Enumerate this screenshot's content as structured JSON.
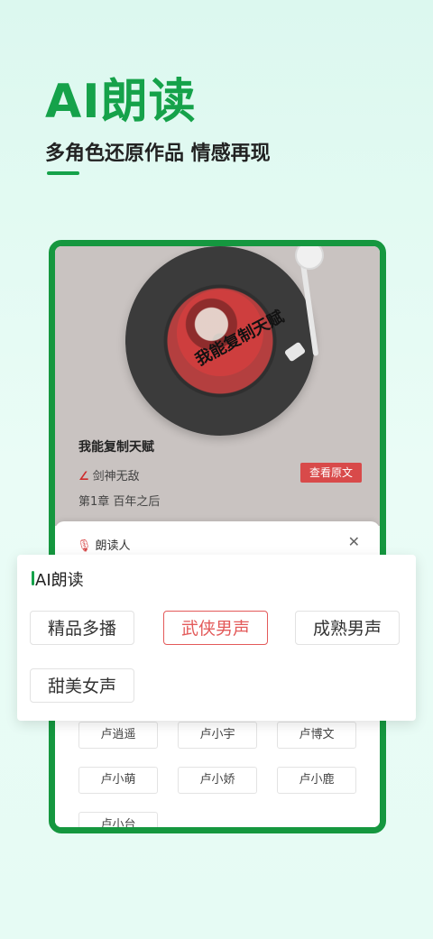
{
  "header": {
    "title": "AI朗读",
    "subtitle": "多角色还原作品  情感再现"
  },
  "book": {
    "disc_text": "我能复制天赋",
    "title": "我能复制天赋",
    "author": "剑神无敌",
    "view_button": "查看原文",
    "chapter": "第1章 百年之后"
  },
  "reader_panel": {
    "title": "朗读人",
    "voices": [
      "卢逍遥",
      "卢小宇",
      "卢博文",
      "卢小萌",
      "卢小娇",
      "卢小鹿",
      "卢小台"
    ]
  },
  "ai_overlay": {
    "title": "AI朗读",
    "options": [
      "精品多播",
      "武侠男声",
      "成熟男声",
      "甜美女声"
    ],
    "selected": "武侠男声"
  },
  "colors": {
    "accent_green": "#15a24a",
    "accent_red": "#e35a5a"
  }
}
